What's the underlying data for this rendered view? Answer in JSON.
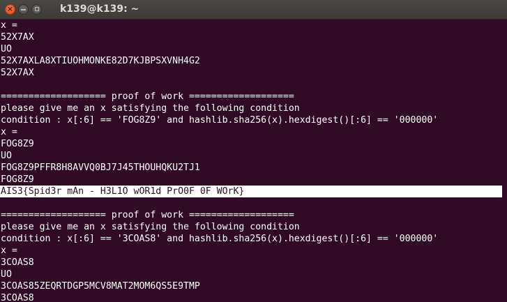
{
  "window": {
    "title": "k139@k139: ~",
    "close_glyph": "×",
    "background": "#300a24",
    "text_color": "#ffffff"
  },
  "terminal": {
    "lines": [
      "x =",
      "52X7AX",
      "UO",
      "52X7AXLA8XTIUOHMONKE82D7KJBPSXVNH4G2",
      "52X7AX",
      "",
      "=================== proof of work ===================",
      "please give me an x satisfying the following condition",
      "condition : x[:6] == 'FOG8Z9' and hashlib.sha256(x).hexdigest()[:6] == '000000'",
      "x =",
      "FOG8Z9",
      "UO",
      "FOG8Z9PFFR8H8AVVQ0BJ7J45THOUHQKU2TJ1",
      "FOG8Z9",
      "AIS3{Spid3r mAn - H3L1O wOR1d PrO0F 0F WOrK}",
      "",
      "=================== proof of work ===================",
      "please give me an x satisfying the following condition",
      "condition : x[:6] == '3COAS8' and hashlib.sha256(x).hexdigest()[:6] == '000000'",
      "x =",
      "3COAS8",
      "UO",
      "3COAS85ZEQRTDGP5MCV8MAT2MOM6QS5E9TMP",
      "3COAS8"
    ],
    "highlighted_line": 14
  }
}
